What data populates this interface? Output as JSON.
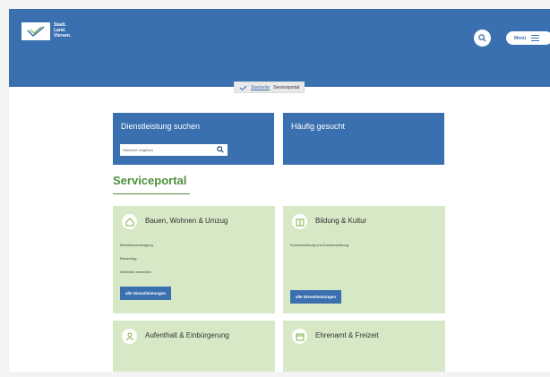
{
  "header": {
    "logo_text_lines": [
      "Stadt.",
      "Land.",
      "Viersen."
    ],
    "menu_label": "Menü"
  },
  "breadcrumb": {
    "home": "Startseite",
    "current": "Serviceportal"
  },
  "search_box": {
    "title": "Dienstleistung suchen",
    "placeholder": "Stichwort eingeben"
  },
  "frequent_box": {
    "title": "Häufig gesucht"
  },
  "main": {
    "title": "Serviceportal"
  },
  "cards": [
    {
      "title": "Bauen, Wohnen & Umzug",
      "items": [
        "Meldebescheinigung",
        "Bauantrag",
        "Wohnsitz anmelden"
      ],
      "button": "alle Dienstleistungen"
    },
    {
      "title": "Bildung & Kultur",
      "items": [
        "Kursanmeldung und Kursabmeldung"
      ],
      "button": "alle Dienstleistungen"
    },
    {
      "title": "Aufenthalt & Einbürgerung"
    },
    {
      "title": "Ehrenamt & Freizeit"
    }
  ],
  "colors": {
    "header_blue": "#3a6fb0",
    "card_green": "#d6e8c5",
    "accent_green": "#4d8f3a"
  }
}
